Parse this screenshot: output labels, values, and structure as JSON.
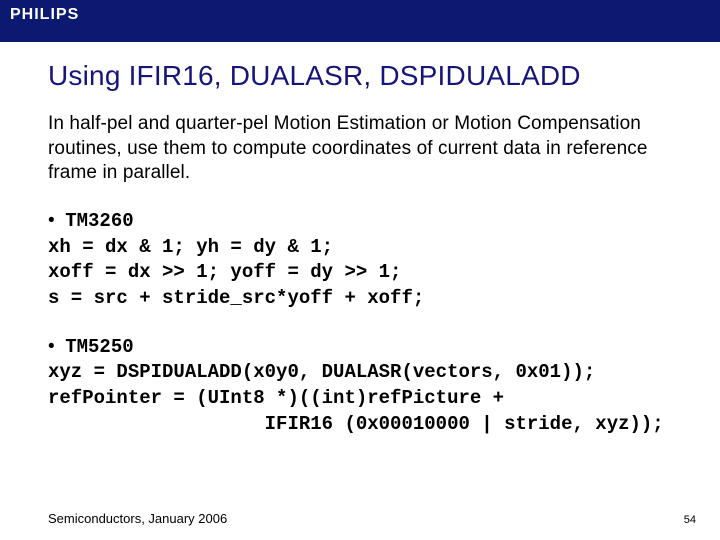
{
  "header": {
    "brand": "PHILIPS"
  },
  "slide": {
    "title": "Using IFIR16, DUALASR, DSPIDUALADD",
    "body": "In half-pel and quarter-pel Motion Estimation or Motion Compensation routines, use them to compute coordinates of current data in reference frame in parallel."
  },
  "block1": {
    "bullet": "TM3260",
    "lines": [
      "xh = dx & 1; yh = dy & 1;",
      "xoff = dx >> 1; yoff = dy >> 1;",
      "s = src + stride_src*yoff + xoff;"
    ]
  },
  "block2": {
    "bullet": "TM5250",
    "lines": [
      "xyz = DSPIDUALADD(x0y0, DUALASR(vectors, 0x01));",
      "refPointer = (UInt8 *)((int)refPicture +",
      "                   IFIR16 (0x00010000 | stride, xyz));"
    ]
  },
  "footer": {
    "text": "Semiconductors, January 2006",
    "page": "54"
  }
}
